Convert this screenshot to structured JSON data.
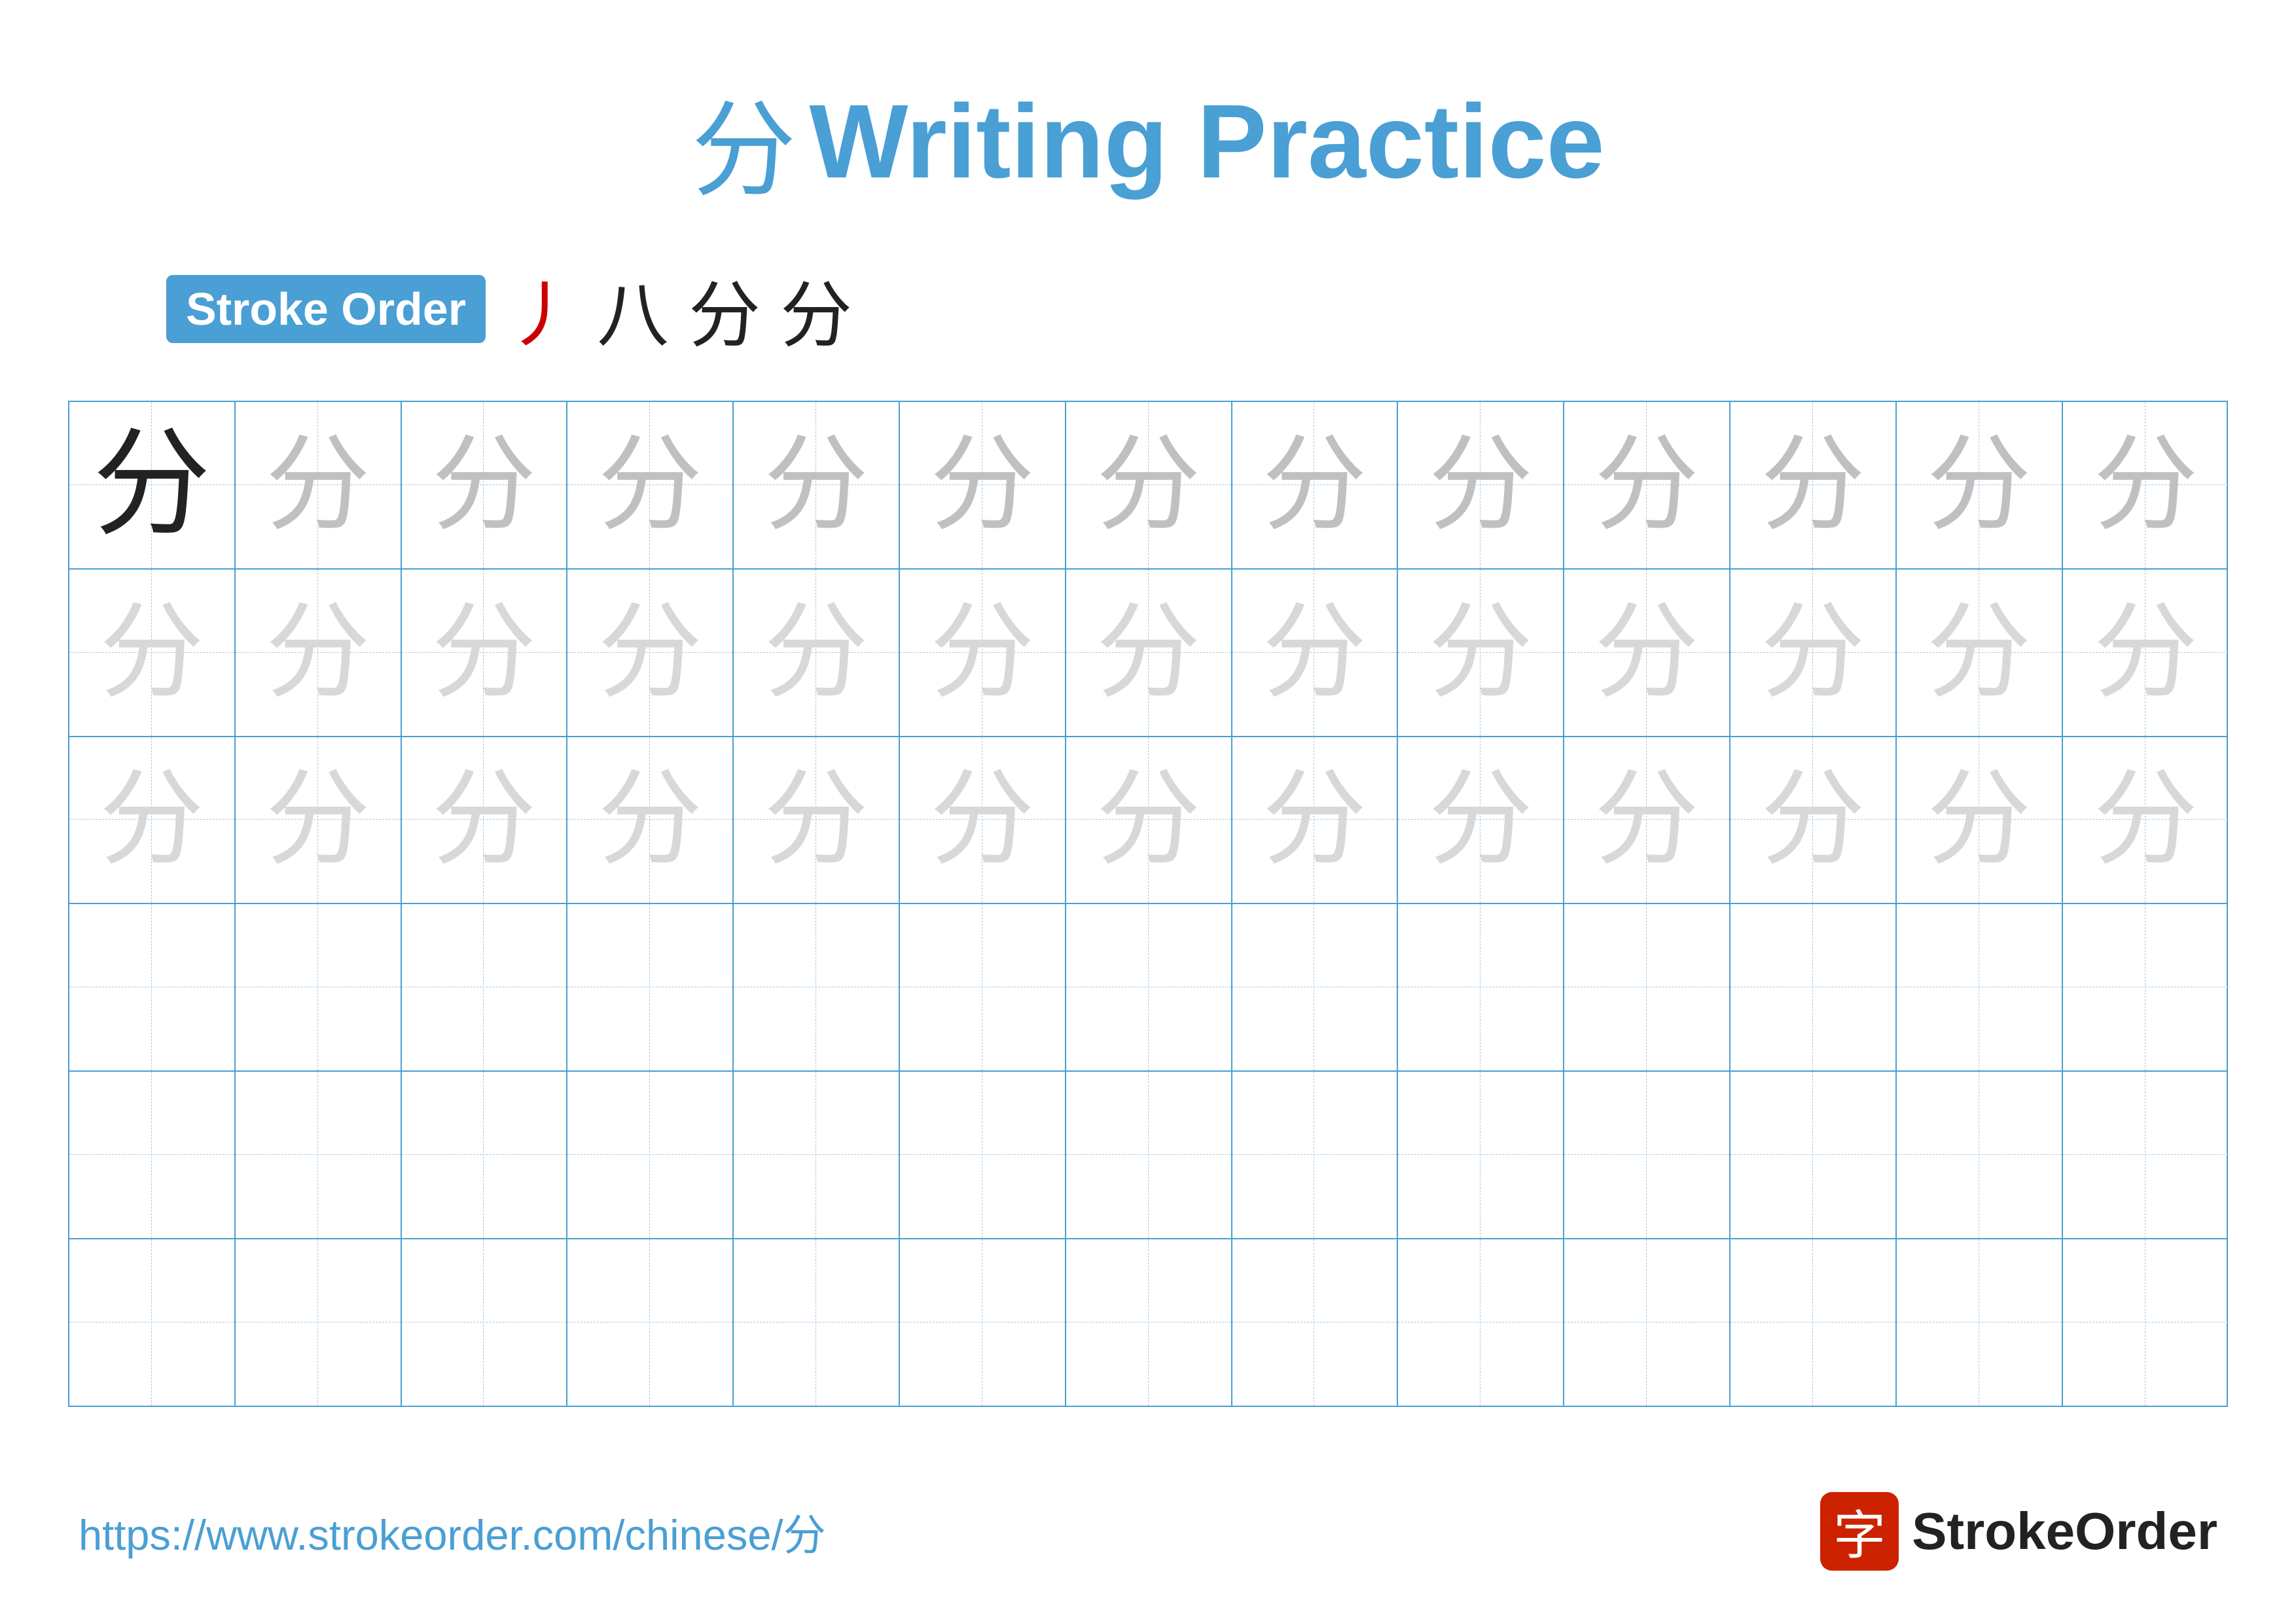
{
  "title": {
    "char": "分",
    "text": "Writing Practice"
  },
  "stroke_order": {
    "badge_label": "Stroke Order",
    "strokes": [
      "丿",
      "八",
      "分",
      "分"
    ]
  },
  "grid": {
    "rows": 6,
    "cols": 13,
    "row_types": [
      "dark_first_medium_rest",
      "light",
      "lighter",
      "empty",
      "empty",
      "empty"
    ]
  },
  "footer": {
    "url": "https://www.strokeorder.com/chinese/分",
    "logo_char": "字",
    "logo_name": "StrokeOrder"
  },
  "colors": {
    "primary": "#4a9fd4",
    "dark_char": "#222222",
    "medium_gray": "#c0c0c0",
    "light_gray": "#d8d8d8",
    "red": "#cc0000",
    "badge_bg": "#4a9fd4",
    "badge_text": "#ffffff"
  }
}
